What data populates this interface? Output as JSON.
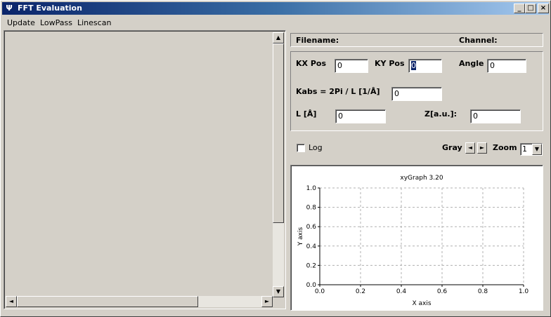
{
  "window": {
    "title": "FFT Evaluation",
    "app_icon": "Ψ",
    "controls": {
      "minimize": "_",
      "maximize": "□",
      "close": "×"
    }
  },
  "menu": [
    "Update",
    "LowPass",
    "Linescan"
  ],
  "header": {
    "filename_label": "Filename:",
    "channel_label": "Channel:"
  },
  "params": {
    "kx_label": "KX Pos",
    "kx_value": "0",
    "ky_label": "KY Pos",
    "ky_value": "0",
    "angle_label": "Angle",
    "angle_value": "0",
    "kabs_label": "Kabs = 2Pi / L [1/Å]",
    "kabs_value": "0",
    "l_label": "L [Å]",
    "l_value": "0",
    "z_label": "Z[a.u.]:",
    "z_value": "0"
  },
  "controls_row": {
    "log_label": "Log",
    "log_checked": false,
    "gray_label": "Gray",
    "zoom_label": "Zoom",
    "zoom_value": "1"
  },
  "scroll": {
    "up": "▲",
    "down": "▼",
    "left": "◄",
    "right": "►"
  },
  "chart_data": {
    "type": "line",
    "title": "xyGraph 3.20",
    "xlabel": "X axis",
    "ylabel": "Y axis",
    "xlim": [
      0.0,
      1.0
    ],
    "ylim": [
      0.0,
      1.0
    ],
    "x_ticks": [
      "0.0",
      "0.2",
      "0.4",
      "0.6",
      "0.8",
      "1.0"
    ],
    "y_ticks": [
      "0.0",
      "0.2",
      "0.4",
      "0.6",
      "0.8",
      "1.0"
    ],
    "grid": true,
    "series": []
  }
}
